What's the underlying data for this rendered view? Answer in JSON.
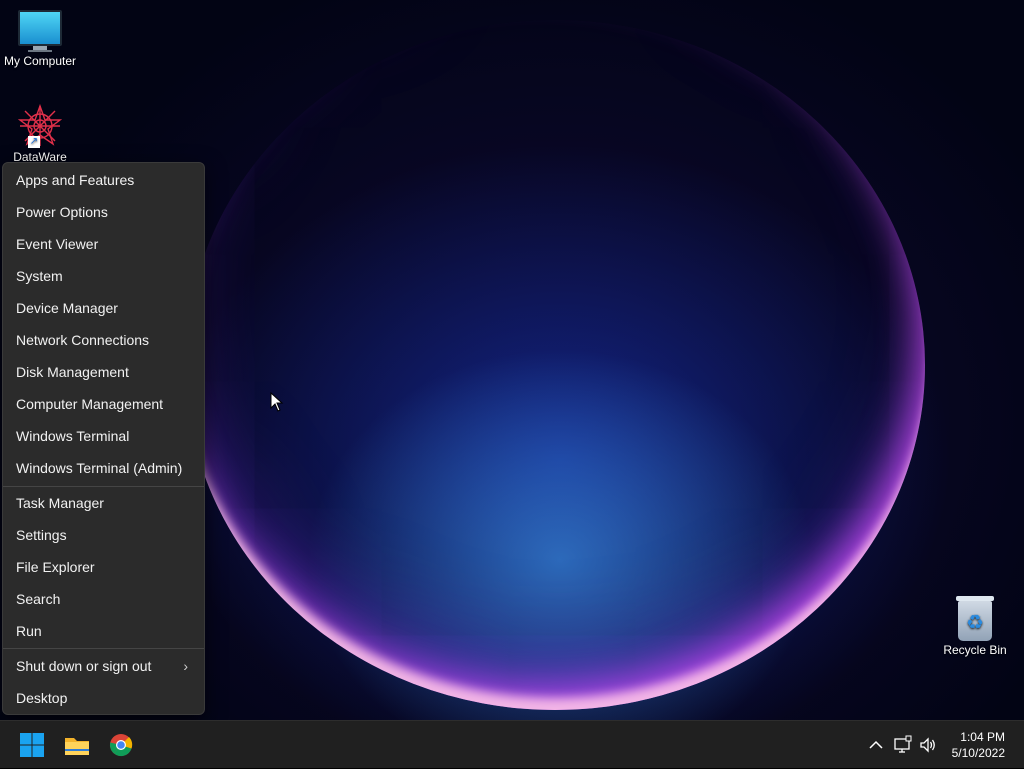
{
  "desktop": {
    "icons": [
      {
        "label": "My Computer",
        "icon": "monitor-icon"
      },
      {
        "label": "DataWare",
        "icon": "burst-icon"
      },
      {
        "label": "Recycle Bin",
        "icon": "recycle-bin-icon"
      }
    ]
  },
  "context_menu": {
    "items": [
      {
        "label": "Apps and Features"
      },
      {
        "label": "Power Options"
      },
      {
        "label": "Event Viewer"
      },
      {
        "label": "System"
      },
      {
        "label": "Device Manager"
      },
      {
        "label": "Network Connections"
      },
      {
        "label": "Disk Management"
      },
      {
        "label": "Computer Management"
      },
      {
        "label": "Windows Terminal"
      },
      {
        "label": "Windows Terminal (Admin)"
      },
      {
        "label": "Task Manager"
      },
      {
        "label": "Settings"
      },
      {
        "label": "File Explorer"
      },
      {
        "label": "Search"
      },
      {
        "label": "Run"
      },
      {
        "label": "Shut down or sign out",
        "submenu": true
      },
      {
        "label": "Desktop"
      }
    ],
    "submenu_glyph": "›"
  },
  "taskbar": {
    "pinned": [
      {
        "name": "start-button",
        "icon": "windows-logo-icon"
      },
      {
        "name": "file-explorer-button",
        "icon": "folder-icon"
      },
      {
        "name": "chrome-button",
        "icon": "chrome-icon"
      }
    ],
    "tray": {
      "icons": [
        "chevron-up-icon",
        "network-icon",
        "volume-icon"
      ],
      "time": "1:04 PM",
      "date": "5/10/2022"
    }
  },
  "colors": {
    "menu_bg": "#2b2b2b",
    "taskbar_bg": "#202020",
    "accent": "#0078d4"
  }
}
